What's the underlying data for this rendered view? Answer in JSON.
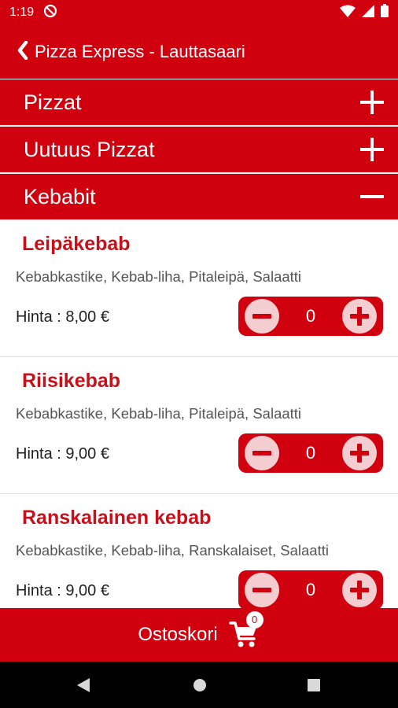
{
  "status_bar": {
    "time": "1:19"
  },
  "app_bar": {
    "title": "Pizza Express - Lauttasaari"
  },
  "categories": [
    {
      "label": "Pizzat",
      "state": "collapsed"
    },
    {
      "label": "Uutuus Pizzat",
      "state": "collapsed"
    },
    {
      "label": "Kebabit",
      "state": "expanded"
    }
  ],
  "items": [
    {
      "name": "Leipäkebab",
      "description": "Kebabkastike, Kebab-liha, Pitaleipä, Salaatti",
      "price": "Hinta : 8,00 €",
      "quantity": "0"
    },
    {
      "name": "Riisikebab",
      "description": "Kebabkastike, Kebab-liha, Pitaleipä, Salaatti",
      "price": "Hinta : 9,00 €",
      "quantity": "0"
    },
    {
      "name": "Ranskalainen kebab",
      "description": "Kebabkastike, Kebab-liha, Ranskalaiset, Salaatti",
      "price": "Hinta : 9,00 €",
      "quantity": "0"
    }
  ],
  "cart": {
    "label": "Ostoskori",
    "count": "0"
  },
  "colors": {
    "brand_red": "#d0000f",
    "title_red": "#c8101a",
    "stepper_button": "#f4cdd0"
  },
  "icons": {
    "back": "chevron-left-icon",
    "expand": "plus-icon",
    "collapse": "minus-icon",
    "cart": "shopping-cart-icon",
    "nav": [
      "back-triangle-icon",
      "home-circle-icon",
      "recents-square-icon"
    ]
  }
}
